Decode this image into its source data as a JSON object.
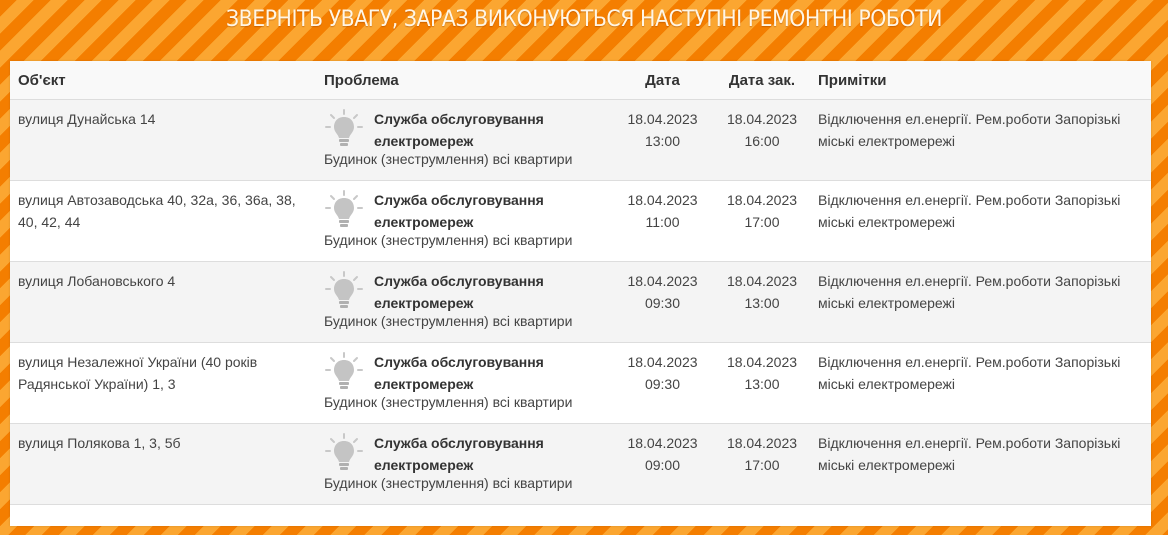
{
  "banner": {
    "title": "ЗВЕРНІТЬ УВАГУ, ЗАРАЗ ВИКОНУЮТЬСЯ НАСТУПНІ РЕМОНТНІ РОБОТИ"
  },
  "table": {
    "headers": {
      "object": "Об'єкт",
      "problem": "Проблема",
      "date": "Дата",
      "date_end": "Дата зак.",
      "notes": "Примітки"
    },
    "rows": [
      {
        "object": "вулиця Дунайська 14",
        "service": "Служба обслуговування електромереж",
        "subtype": "Будинок (знеструмлення) всі квартири",
        "date": "18.04.2023",
        "time": "13:00",
        "date_end": "18.04.2023",
        "time_end": "16:00",
        "notes": "Відключення ел.енергії. Рем.роботи Запорізькі міські електромережі"
      },
      {
        "object": "вулиця Автозаводська 40, 32а, 36, 36а, 38, 40, 42, 44",
        "service": "Служба обслуговування електромереж",
        "subtype": "Будинок (знеструмлення) всі квартири",
        "date": "18.04.2023",
        "time": "11:00",
        "date_end": "18.04.2023",
        "time_end": "17:00",
        "notes": "Відключення ел.енергії. Рем.роботи Запорізькі міські електромережі"
      },
      {
        "object": "вулиця Лобановського 4",
        "service": "Служба обслуговування електромереж",
        "subtype": "Будинок (знеструмлення) всі квартири",
        "date": "18.04.2023",
        "time": "09:30",
        "date_end": "18.04.2023",
        "time_end": "13:00",
        "notes": "Відключення ел.енергії. Рем.роботи Запорізькі міські електромережі"
      },
      {
        "object": "вулиця Незалежної України (40 років Радянської України) 1, 3",
        "service": "Служба обслуговування електромереж",
        "subtype": "Будинок (знеструмлення) всі квартири",
        "date": "18.04.2023",
        "time": "09:30",
        "date_end": "18.04.2023",
        "time_end": "13:00",
        "notes": "Відключення ел.енергії. Рем.роботи Запорізькі міські електромережі"
      },
      {
        "object": "вулиця Полякова 1, 3, 5б",
        "service": "Служба обслуговування електромереж",
        "subtype": "Будинок (знеструмлення) всі квартири",
        "date": "18.04.2023",
        "time": "09:00",
        "date_end": "18.04.2023",
        "time_end": "17:00",
        "notes": "Відключення ел.енергії. Рем.роботи Запорізькі міські електромережі"
      }
    ]
  },
  "icons": {
    "problem_icon": "lightbulb-icon"
  },
  "colors": {
    "stripe_dark": "#f47e00",
    "stripe_light": "#fba631",
    "row_alt": "#f4f4f4"
  }
}
